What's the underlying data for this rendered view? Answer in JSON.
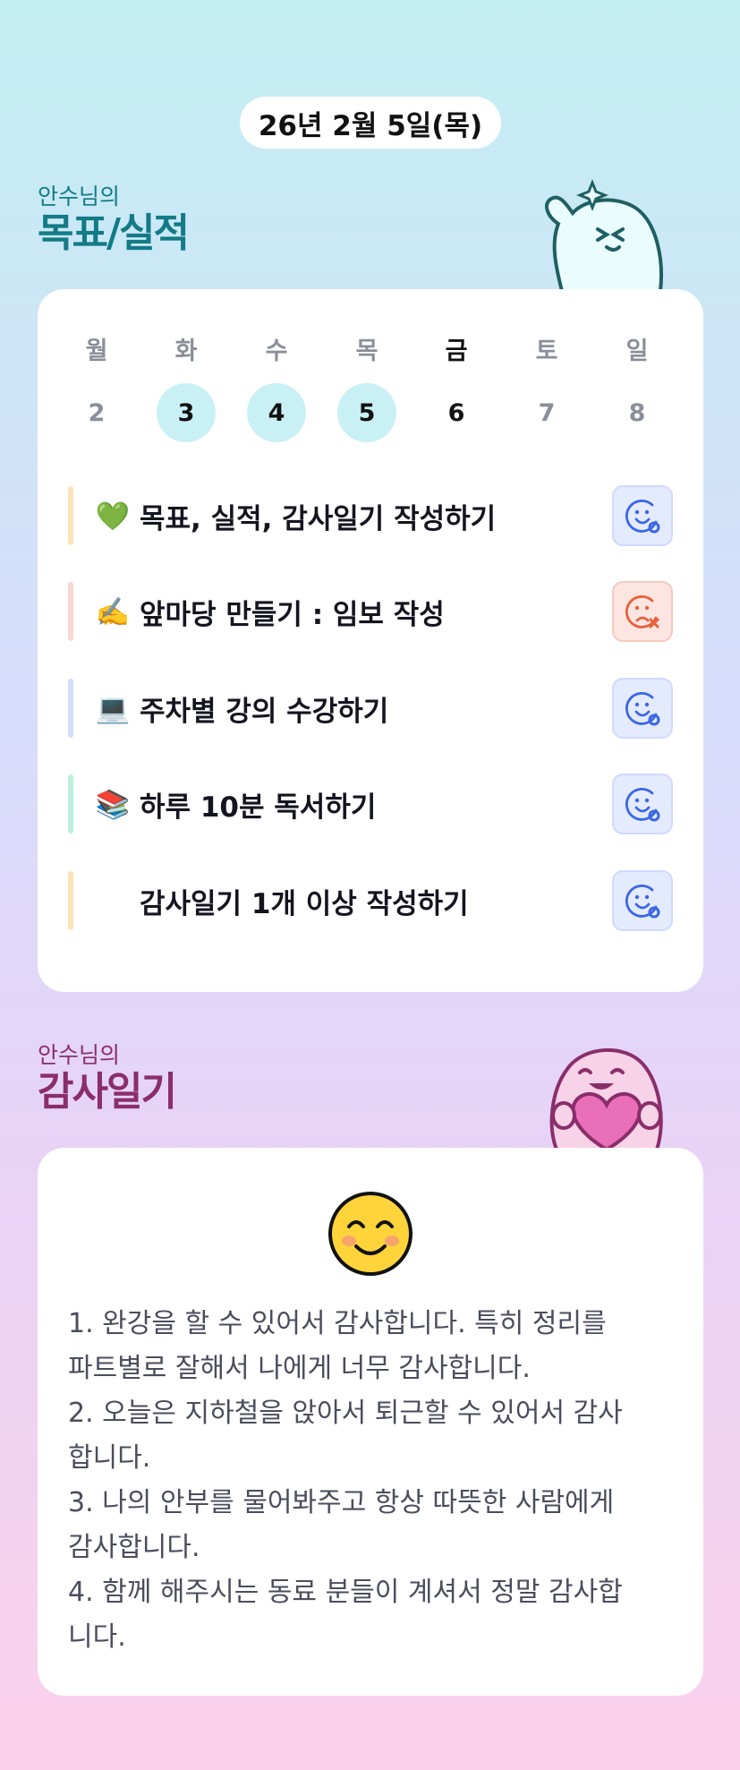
{
  "date": "26년 2월 5일(목)",
  "goals_section": {
    "owner": "안수님의",
    "title": "목표/실적"
  },
  "week": {
    "days": [
      "월",
      "화",
      "수",
      "목",
      "금",
      "토",
      "일"
    ],
    "dates": [
      "2",
      "3",
      "4",
      "5",
      "6",
      "7",
      "8"
    ],
    "today_index": 4,
    "completed_indices": [
      1,
      2,
      3
    ]
  },
  "goals": [
    {
      "emoji": "💚",
      "emoji_icon": "green-heart-icon",
      "text": "목표, 실적, 감사일기 작성하기",
      "bar_color": "#fde3b8",
      "status": "success"
    },
    {
      "emoji": "✍️",
      "emoji_icon": "writing-hand-icon",
      "text": "앞마당 만들기 : 임보 작성",
      "bar_color": "#fbd6d2",
      "status": "fail"
    },
    {
      "emoji": "💻",
      "emoji_icon": "laptop-icon",
      "text": "주차별 강의 수강하기",
      "bar_color": "#d4dcfb",
      "status": "success"
    },
    {
      "emoji": "📚",
      "emoji_icon": "books-icon",
      "text": "하루 10분 독서하기",
      "bar_color": "#bdf0da",
      "status": "success"
    },
    {
      "emoji": "",
      "emoji_icon": "",
      "text": "감사일기 1개 이상 작성하기",
      "bar_color": "#fde3b8",
      "status": "success"
    }
  ],
  "gratitude_section": {
    "owner": "안수님의",
    "title": "감사일기"
  },
  "gratitude": {
    "mood_icon": "smiling-face-icon",
    "lines": [
      "1. 완강을 할 수 있어서 감사합니다. 특히 정리를",
      "파트별로 잘해서 나에게 너무 감사합니다.",
      "2. 오늘은 지하철을 앉아서 퇴근할 수 있어서 감사",
      "합니다.",
      "3. 나의 안부를 물어봐주고 항상 따뜻한 사람에게",
      "감사합니다.",
      "4. 함께 해주시는 동료 분들이 계셔서 정말 감사합",
      "니다."
    ]
  },
  "colors": {
    "teal_accent": "#137a86",
    "plum_accent": "#8a2e6b",
    "success_blue": "#3b66e6",
    "fail_red": "#e8603c"
  }
}
